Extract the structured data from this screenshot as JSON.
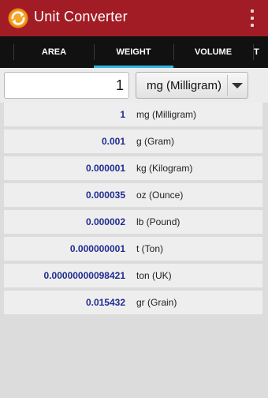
{
  "app": {
    "title": "Unit Converter",
    "icon": "refresh-arrows-icon",
    "brand_color": "#a11c24"
  },
  "tabs": [
    {
      "label": ""
    },
    {
      "label": "AREA"
    },
    {
      "label": "WEIGHT",
      "selected": true
    },
    {
      "label": "VOLUME"
    },
    {
      "label": "T"
    }
  ],
  "input": {
    "value": "1",
    "unit": "mg (Milligram)"
  },
  "results": [
    {
      "value": "1",
      "unit": "mg (Milligram)"
    },
    {
      "value": "0.001",
      "unit": "g (Gram)"
    },
    {
      "value": "0.000001",
      "unit": "kg (Kilogram)"
    },
    {
      "value": "0.000035",
      "unit": "oz (Ounce)"
    },
    {
      "value": "0.000002",
      "unit": "lb (Pound)"
    },
    {
      "value": "0.000000001",
      "unit": "t (Ton)"
    },
    {
      "value": "0.00000000098421",
      "unit": "ton (UK)"
    },
    {
      "value": "0.015432",
      "unit": "gr (Grain)"
    }
  ],
  "colors": {
    "value_text": "#1f2c8f",
    "tab_indicator": "#33b5e5"
  }
}
